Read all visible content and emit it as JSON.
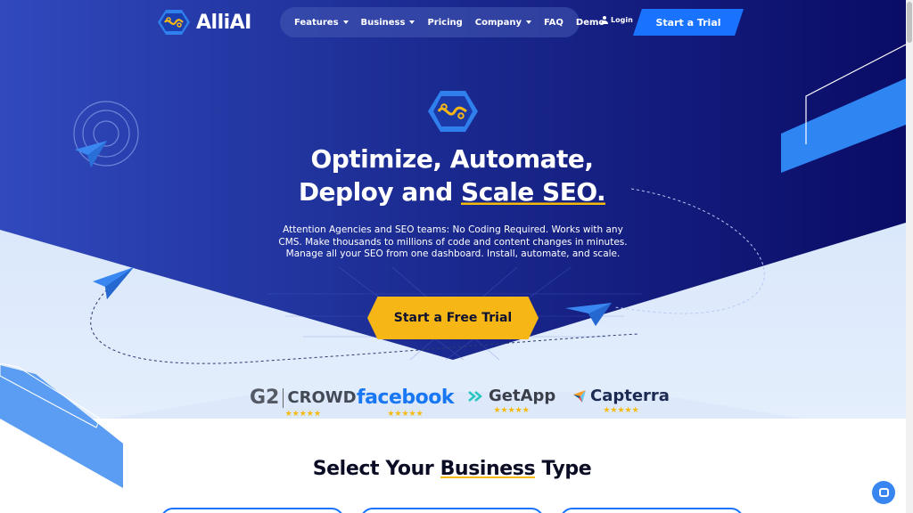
{
  "brand": {
    "name": "AlliAI"
  },
  "nav": {
    "items": [
      {
        "label": "Features",
        "dropdown": true
      },
      {
        "label": "Business",
        "dropdown": true
      },
      {
        "label": "Pricing",
        "dropdown": false
      },
      {
        "label": "Company",
        "dropdown": true
      },
      {
        "label": "FAQ",
        "dropdown": false
      },
      {
        "label": "Demo",
        "dropdown": false
      }
    ],
    "login": "Login",
    "cta": "Start a Trial"
  },
  "hero": {
    "headline_line1": "Optimize, Automate,",
    "headline_line2_pre": "Deploy and ",
    "headline_line2_underlined": "Scale SEO.",
    "subtext": "Attention Agencies and SEO teams: No Coding Required. Works with any CMS. Make thousands to millions of code and content changes in minutes. Manage all your SEO from one dashboard. Install, automate, and scale.",
    "cta": "Start a Free Trial"
  },
  "reviews": [
    {
      "name": "CROWD",
      "prefix": "G2",
      "stars": "★★★★★",
      "icon": "g2-crowd-logo"
    },
    {
      "name": "facebook",
      "stars": "★★★★★",
      "icon": "facebook-logo"
    },
    {
      "name": "GetApp",
      "stars": "★★★★★",
      "icon": "getapp-logo"
    },
    {
      "name": "Capterra",
      "stars": "★★★★★",
      "icon": "capterra-logo"
    }
  ],
  "section": {
    "title_pre": "Select Your ",
    "title_underlined": "Business",
    "title_post": " Type"
  },
  "colors": {
    "primary": "#1a73ff",
    "accent": "#f6b616",
    "dark_bg": "#0b0d6b",
    "light_bg": "#c9dcf7"
  }
}
